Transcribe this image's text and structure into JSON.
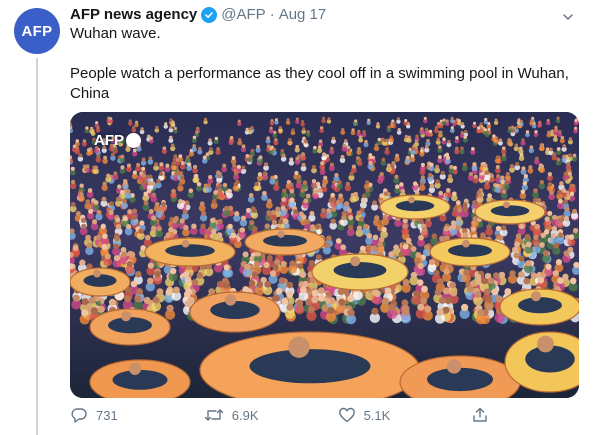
{
  "tweet": {
    "avatar_text": "AFP",
    "name": "AFP news agency",
    "handle": "@AFP",
    "separator": "·",
    "date": "Aug 17",
    "text_line1": "Wuhan wave.",
    "text_line2": "People watch a performance as they cool off in a swimming pool in Wuhan, China",
    "media_watermark": "AFP",
    "colors": {
      "avatar_bg": "#3a5fc8",
      "verified": "#1da1f2",
      "secondary_text": "#657786"
    },
    "icons": {
      "verified": "verified-badge-icon",
      "caret": "chevron-down-icon",
      "reply": "reply-icon",
      "retweet": "retweet-icon",
      "like": "heart-icon",
      "share": "share-icon"
    }
  },
  "actions": {
    "replies": "731",
    "retweets": "6.9K",
    "likes": "5.1K"
  }
}
